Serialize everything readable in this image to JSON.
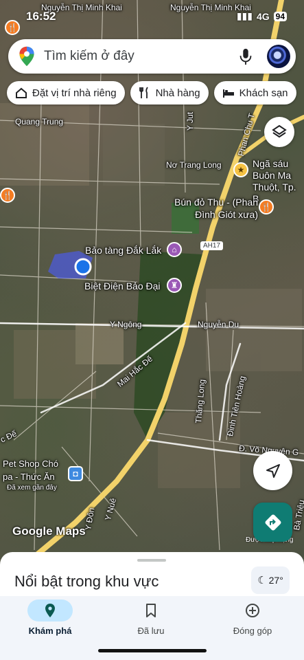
{
  "status_bar": {
    "time": "16:52",
    "network": "4G",
    "battery": "94"
  },
  "search": {
    "placeholder": "Tìm kiếm ở đây",
    "icons": [
      "maps-pin-logo",
      "mic-icon",
      "avatar"
    ]
  },
  "chips": [
    {
      "label": "Đặt vị trí nhà riêng",
      "icon": "home-icon"
    },
    {
      "label": "Nhà hàng",
      "icon": "fork-knife-icon"
    },
    {
      "label": "Khách sạn",
      "icon": "bed-icon"
    }
  ],
  "map": {
    "streets": {
      "nguyen_thi_minh_khai_1": "Nguyễn Thị Minh Khai",
      "nguyen_thi_minh_khai_2": "Nguyễn Thị Minh Khai",
      "quang_trung": "Quang Trung",
      "no_trang_long": "Nơ Trang Long",
      "y_ngong": "Y Ngông",
      "nguyen_du": "Nguyễn Du",
      "mai_hac_de": "Mai Hắc Đế",
      "thang_long": "Thăng Long",
      "dinh_tien_hoang": "Đinh Tiên Hoàng",
      "vo_nguyen_giap": "Đ. Võ Nguyên G",
      "phan_chu_trinh": "Phan Chu T",
      "y_jut": "Y Jut",
      "ah17": "AH17",
      "y_don": "Y Đôn",
      "y_nue": "Y Nuê",
      "de": "c Đế",
      "ba_trieu": "Bà Triệu"
    },
    "pois": {
      "nga_sau": "Ngã sáu Buôn Ma Thuột, Tp. B",
      "bun_do": "Bún đỏ Thu - (Phan Đình Giót xưa)",
      "bao_tang": "Bảo tàng Đắk Lắk",
      "biet_dien": "Biệt Điện Bảo Đại",
      "pet_shop": "Pet Shop Chó",
      "spa": "pa - Thức Ăn",
      "viewed_recently": "Đã xem gần đây"
    }
  },
  "map_branding": {
    "logo": "Google Maps",
    "attribution": "Được xếp hạng"
  },
  "sheet": {
    "title": "Nổi bật trong khu vực",
    "temperature": "27°"
  },
  "nav": [
    {
      "label": "Khám phá",
      "icon": "explore-pin-icon",
      "active": true
    },
    {
      "label": "Đã lưu",
      "icon": "bookmark-icon",
      "active": false
    },
    {
      "label": "Đóng góp",
      "icon": "add-circle-icon",
      "active": false
    }
  ],
  "colors": {
    "accent": "#c2e7ff",
    "directions": "#0f7c73",
    "road_major": "#f2d26a",
    "location_dot": "#1a73e8"
  }
}
